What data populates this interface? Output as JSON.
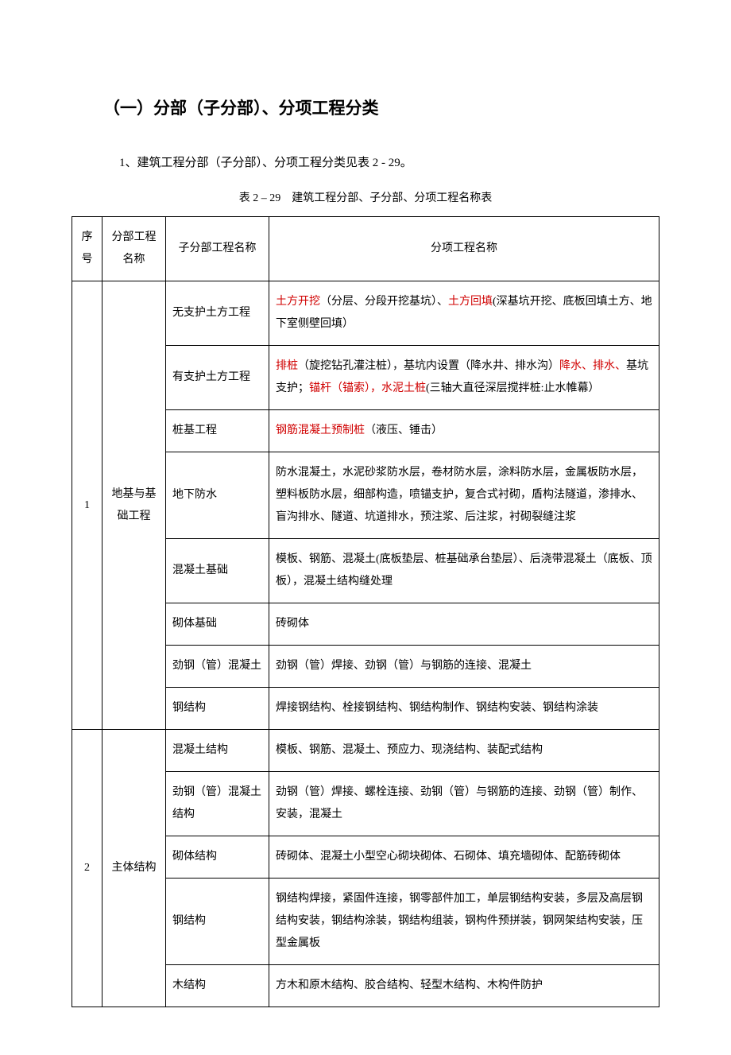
{
  "section_title": "（一）分部（子分部）、分项工程分类",
  "intro": "1、建筑工程分部（子分部）、分项工程分类见表 2 - 29。",
  "table_caption": "表 2 – 29　建筑工程分部、子分部、分项工程名称表",
  "headers": {
    "seq": "序号",
    "part": "分部工程名称",
    "subpart": "子分部工程名称",
    "item": "分项工程名称"
  },
  "groups": [
    {
      "seq": "1",
      "part": "地基与基础工程",
      "rows": [
        {
          "subpart": "无支护土方工程",
          "item": [
            {
              "t": "土方开挖",
              "red": true
            },
            {
              "t": "（分层、分段开挖基坑）、"
            },
            {
              "t": "土方回填",
              "red": true
            },
            {
              "t": "(深基坑开挖、底板回填土方、地下室侧壁回填）"
            }
          ]
        },
        {
          "subpart": "有支护土方工程",
          "item": [
            {
              "t": "排桩",
              "red": true
            },
            {
              "t": "（旋挖钻孔灌注桩），基坑内设置（降水井、排水沟）"
            },
            {
              "t": "降水、排水、",
              "red": true
            },
            {
              "t": "基坑支护；"
            },
            {
              "t": "锚杆（锚索），水泥土桩",
              "red": true
            },
            {
              "t": "(三轴大直径深层搅拌桩:止水帷幕）"
            }
          ]
        },
        {
          "subpart": "桩基工程",
          "item": [
            {
              "t": "钢筋混凝土预制桩",
              "red": true
            },
            {
              "t": "（液压、锤击）"
            }
          ]
        },
        {
          "subpart": "地下防水",
          "item": [
            {
              "t": "防水混凝土，水泥砂浆防水层，卷材防水层，涂料防水层，金属板防水层，塑料板防水层，细部构造，喷锚支护，复合式衬砌，盾构法隧道，渗排水、盲沟排水、隧道、坑道排水，预注浆、后注浆，衬砌裂缝注浆"
            }
          ]
        },
        {
          "subpart": "混凝土基础",
          "item": [
            {
              "t": "模板、钢筋、混凝土(底板垫层、桩基础承台垫层）、后浇带混凝土（底板、顶板），混凝土结构缝处理"
            }
          ]
        },
        {
          "subpart": "砌体基础",
          "item": [
            {
              "t": "砖砌体"
            }
          ]
        },
        {
          "subpart": "劲钢（管）混凝土",
          "item": [
            {
              "t": "劲钢（管）焊接、劲钢（管）与钢筋的连接、混凝土"
            }
          ]
        },
        {
          "subpart": "钢结构",
          "item": [
            {
              "t": "焊接钢结构、栓接钢结构、钢结构制作、钢结构安装、钢结构涂装"
            }
          ]
        }
      ]
    },
    {
      "seq": "2",
      "part": "主体结构",
      "rows": [
        {
          "subpart": "混凝土结构",
          "item": [
            {
              "t": "模板、钢筋、混凝土、预应力、现浇结构、装配式结构"
            }
          ]
        },
        {
          "subpart": "劲钢（管）混凝土结构",
          "item": [
            {
              "t": "劲钢（管）焊接、螺栓连接、劲钢（管）与钢筋的连接、劲钢（管）制作、安装，混凝土"
            }
          ]
        },
        {
          "subpart": "砌体结构",
          "item": [
            {
              "t": "砖砌体、混凝土小型空心砌块砌体、石砌体、填充墙砌体、配筋砖砌体"
            }
          ]
        },
        {
          "subpart": "钢结构",
          "item": [
            {
              "t": "钢结构焊接，紧固件连接，钢零部件加工，单层钢结构安装，多层及高层钢结构安装，钢结构涂装，钢结构组装，钢构件预拼装，钢网架结构安装，压型金属板"
            }
          ]
        },
        {
          "subpart": "木结构",
          "item": [
            {
              "t": "方木和原木结构、胶合结构、轻型木结构、木构件防护"
            }
          ]
        }
      ]
    }
  ]
}
